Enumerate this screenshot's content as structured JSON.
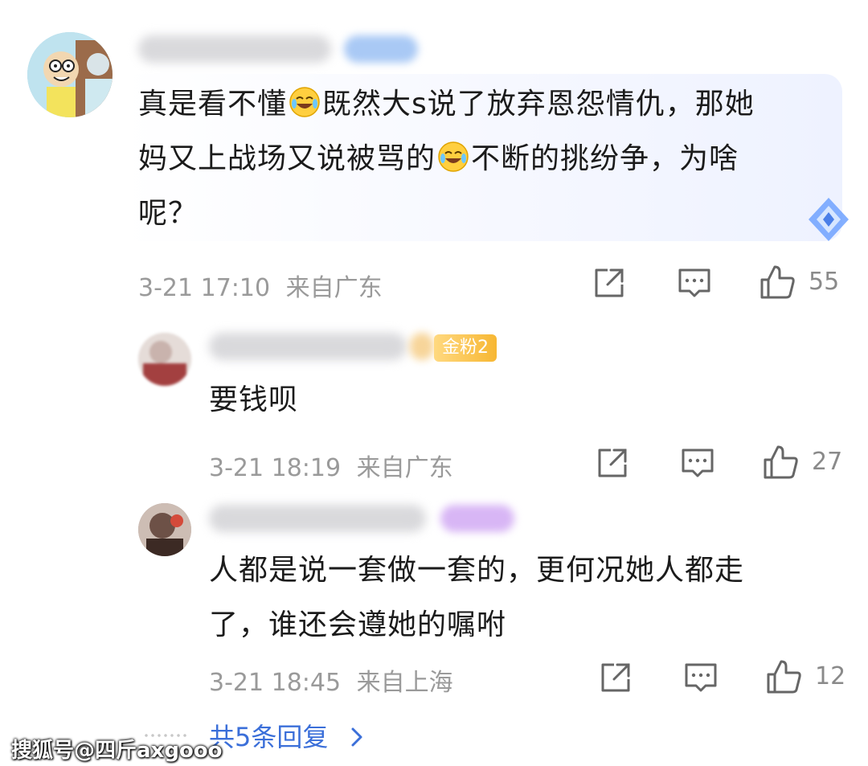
{
  "comments": [
    {
      "text_line1": "真是看不懂",
      "text_line1b": "既然大s说了放弃恩怨情仇，那她",
      "text_line2": "妈又上战场又说被骂的",
      "text_line2b": "不断的挑纷争，为啥",
      "text_line3": "呢？",
      "timestamp": "3-21 17:10",
      "location": "来自广东",
      "like_count": "55"
    },
    {
      "badge": "金粉2",
      "text": "要钱呗",
      "timestamp": "3-21 18:19",
      "location": "来自广东",
      "like_count": "27"
    },
    {
      "text_line1": "人都是说一套做一套的，更何况她人都走",
      "text_line2": "了，谁还会遵她的嘱咐",
      "timestamp": "3-21 18:45",
      "location": "来自上海",
      "like_count": "12"
    }
  ],
  "more_replies": "共5条回复",
  "watermark": "搜狐号@四斤axgooo",
  "icons": [
    "share-icon",
    "comment-icon",
    "like-icon",
    "laugh-cry-emoji",
    "diamond-icon",
    "chevron-right-icon"
  ],
  "colors": {
    "link": "#3b6fd9",
    "meta": "#9a9a9a",
    "badge_gold": "#f7b733"
  }
}
